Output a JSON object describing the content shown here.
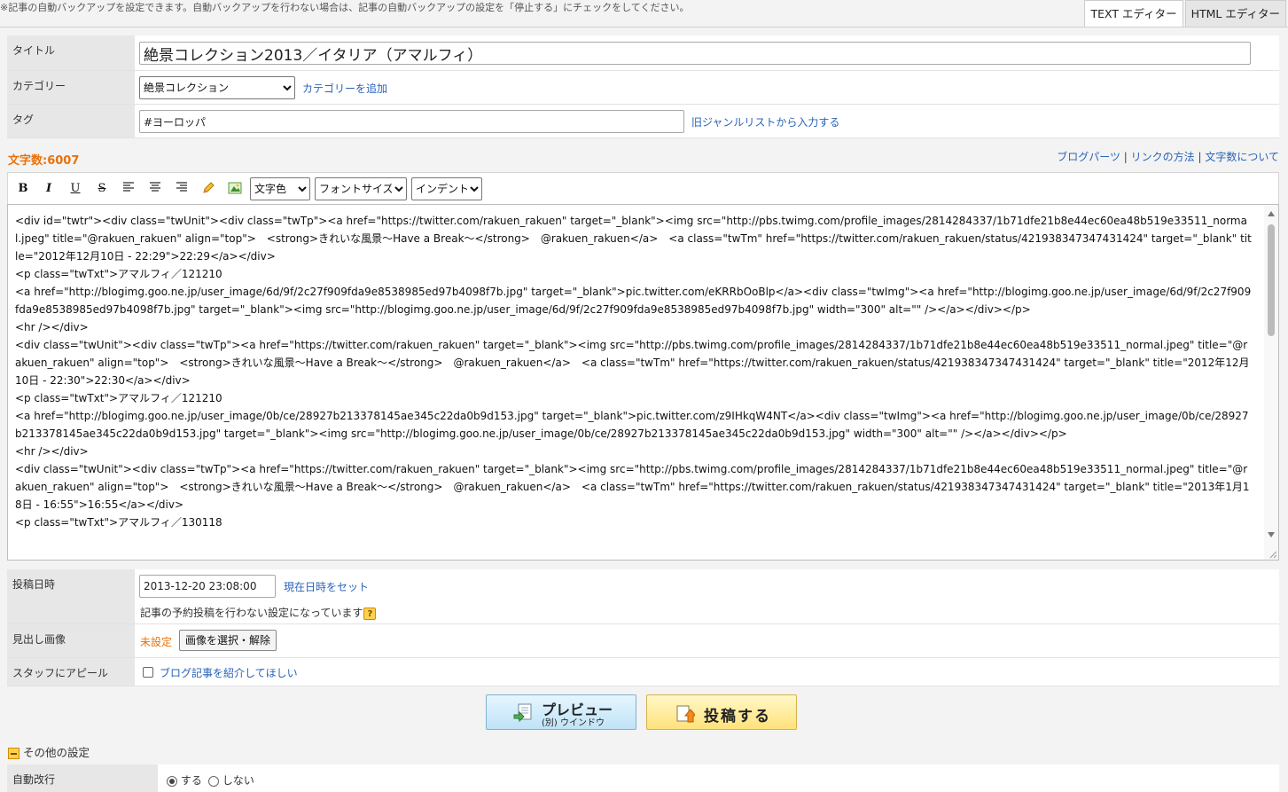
{
  "notice": "※記事の自動バックアップを設定できます。自動バックアップを行わない場合は、記事の自動バックアップの設定を「停止する」にチェックをしてください。",
  "tabs": {
    "text_editor": "TEXT エディター",
    "html_editor": "HTML エディター"
  },
  "form": {
    "title_label": "タイトル",
    "title_value": "絶景コレクション2013／イタリア（アマルフィ）",
    "category_label": "カテゴリー",
    "category_value": "絶景コレクション",
    "category_add": "カテゴリーを追加",
    "tag_label": "タグ",
    "tag_value": "#ヨーロッパ",
    "tag_link": "旧ジャンルリストから入力する"
  },
  "char_count": "文字数:6007",
  "links": {
    "blog_parts": "ブログパーツ",
    "sep": " | ",
    "link_method": "リンクの方法",
    "about_count": "文字数について"
  },
  "toolbar": {
    "bold": "B",
    "italic": "I",
    "underline": "U",
    "strike": "S",
    "text_color": "文字色",
    "font_size": "フォントサイズ",
    "indent": "インデント",
    "icons": [
      "align-left-icon",
      "align-center-icon",
      "align-right-icon",
      "pencil-icon",
      "image-icon"
    ]
  },
  "editor_text": "<div id=\"twtr\"><div class=\"twUnit\"><div class=\"twTp\"><a href=\"https://twitter.com/rakuen_rakuen\" target=\"_blank\"><img src=\"http://pbs.twimg.com/profile_images/2814284337/1b71dfe21b8e44ec60ea48b519e33511_normal.jpeg\" title=\"@rakuen_rakuen\" align=\"top\">　<strong>きれいな風景～Have a Break～</strong>　@rakuen_rakuen</a>　<a class=\"twTm\" href=\"https://twitter.com/rakuen_rakuen/status/421938347347431424\" target=\"_blank\" title=\"2012年12月10日 - 22:29\">22:29</a></div>\n<p class=\"twTxt\">アマルフィ／121210\n<a href=\"http://blogimg.goo.ne.jp/user_image/6d/9f/2c27f909fda9e8538985ed97b4098f7b.jpg\" target=\"_blank\">pic.twitter.com/eKRRbOoBlp</a><div class=\"twImg\"><a href=\"http://blogimg.goo.ne.jp/user_image/6d/9f/2c27f909fda9e8538985ed97b4098f7b.jpg\" target=\"_blank\"><img src=\"http://blogimg.goo.ne.jp/user_image/6d/9f/2c27f909fda9e8538985ed97b4098f7b.jpg\" width=\"300\" alt=\"\" /></a></div></p>\n<hr /></div>\n<div class=\"twUnit\"><div class=\"twTp\"><a href=\"https://twitter.com/rakuen_rakuen\" target=\"_blank\"><img src=\"http://pbs.twimg.com/profile_images/2814284337/1b71dfe21b8e44ec60ea48b519e33511_normal.jpeg\" title=\"@rakuen_rakuen\" align=\"top\">　<strong>きれいな風景～Have a Break～</strong>　@rakuen_rakuen</a>　<a class=\"twTm\" href=\"https://twitter.com/rakuen_rakuen/status/421938347347431424\" target=\"_blank\" title=\"2012年12月10日 - 22:30\">22:30</a></div>\n<p class=\"twTxt\">アマルフィ／121210\n<a href=\"http://blogimg.goo.ne.jp/user_image/0b/ce/28927b213378145ae345c22da0b9d153.jpg\" target=\"_blank\">pic.twitter.com/z9IHkqW4NT</a><div class=\"twImg\"><a href=\"http://blogimg.goo.ne.jp/user_image/0b/ce/28927b213378145ae345c22da0b9d153.jpg\" target=\"_blank\"><img src=\"http://blogimg.goo.ne.jp/user_image/0b/ce/28927b213378145ae345c22da0b9d153.jpg\" width=\"300\" alt=\"\" /></a></div></p>\n<hr /></div>\n<div class=\"twUnit\"><div class=\"twTp\"><a href=\"https://twitter.com/rakuen_rakuen\" target=\"_blank\"><img src=\"http://pbs.twimg.com/profile_images/2814284337/1b71dfe21b8e44ec60ea48b519e33511_normal.jpeg\" title=\"@rakuen_rakuen\" align=\"top\">　<strong>きれいな風景～Have a Break～</strong>　@rakuen_rakuen</a>　<a class=\"twTm\" href=\"https://twitter.com/rakuen_rakuen/status/421938347347431424\" target=\"_blank\" title=\"2013年1月18日 - 16:55\">16:55</a></div>\n<p class=\"twTxt\">アマルフィ／130118",
  "post_date": {
    "label": "投稿日時",
    "value": "2013-12-20 23:08:00",
    "set_now": "現在日時をセット",
    "schedule_note": "記事の予約投稿を行わない設定になっています"
  },
  "heading_image": {
    "label": "見出し画像",
    "status": "未設定",
    "button": "画像を選択・解除"
  },
  "staff_appeal": {
    "label": "スタッフにアピール",
    "link": "ブログ記事を紹介してほしい"
  },
  "buttons": {
    "preview_main": "プレビュー",
    "preview_sub": "(別) ウインドウ",
    "post": "投稿する"
  },
  "other_settings": {
    "title": "その他の設定",
    "auto_break_label": "自動改行",
    "opt_yes": "する",
    "opt_no": "しない"
  },
  "colors": {
    "accent_orange": "#e8720c",
    "link_blue": "#2a63b8",
    "label_bg": "#e7e7e7"
  }
}
